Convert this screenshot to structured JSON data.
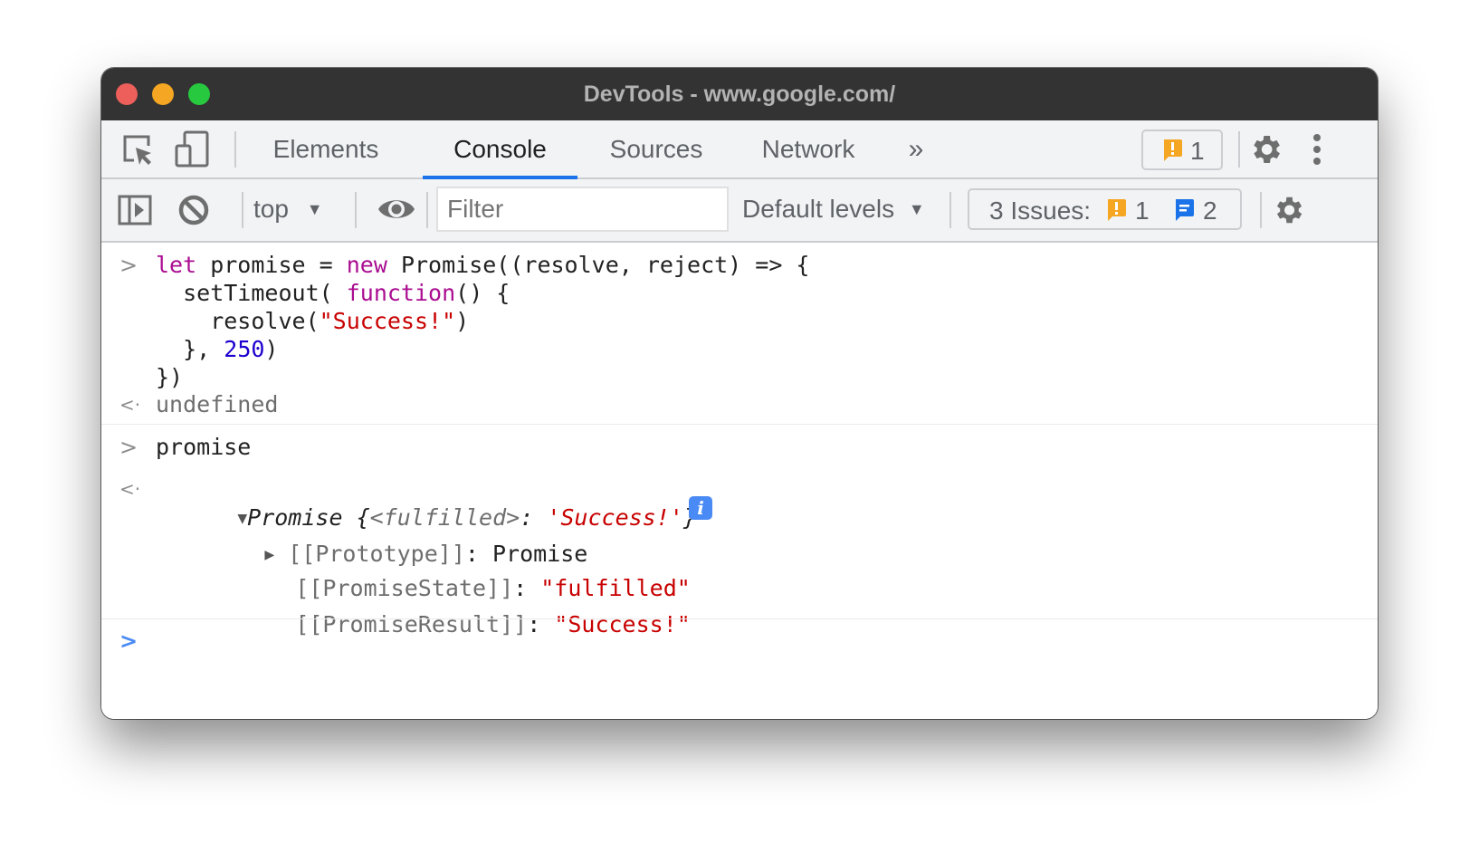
{
  "window": {
    "title": "DevTools - www.google.com/"
  },
  "tabbar": {
    "tabs": [
      {
        "label": "Elements",
        "active": false
      },
      {
        "label": "Console",
        "active": true
      },
      {
        "label": "Sources",
        "active": false
      },
      {
        "label": "Network",
        "active": false
      }
    ],
    "more_tabs_icon": "»",
    "issues_warning_count": "1",
    "settings_icon": "gear-icon",
    "menu_icon": "kebab-menu-icon"
  },
  "console_toolbar": {
    "context_label": "top",
    "filter_placeholder": "Filter",
    "levels_label": "Default levels",
    "issues_label": "3 Issues:",
    "issues_warning_count": "1",
    "issues_info_count": "2"
  },
  "console": {
    "entries": [
      {
        "type": "input",
        "lines": [
          [
            {
              "t": "let",
              "c": "kw"
            },
            {
              "t": " promise = ",
              "c": ""
            },
            {
              "t": "new",
              "c": "kw"
            },
            {
              "t": " Promise((resolve, reject) => {",
              "c": ""
            }
          ],
          [
            {
              "t": "  setTimeout( ",
              "c": ""
            },
            {
              "t": "function",
              "c": "kw"
            },
            {
              "t": "() {",
              "c": ""
            }
          ],
          [
            {
              "t": "    resolve(",
              "c": ""
            },
            {
              "t": "\"Success!\"",
              "c": "str"
            },
            {
              "t": ")",
              "c": ""
            }
          ],
          [
            {
              "t": "  }, ",
              "c": ""
            },
            {
              "t": "250",
              "c": "num"
            },
            {
              "t": ")",
              "c": ""
            }
          ],
          [
            {
              "t": "})",
              "c": ""
            }
          ]
        ]
      },
      {
        "type": "output",
        "text": "undefined"
      },
      {
        "type": "input",
        "text": "promise"
      },
      {
        "type": "output-object",
        "summary": {
          "name": "Promise",
          "open_brace": " {",
          "key": "<fulfilled>",
          "colon": ": ",
          "value": "'Success!'",
          "close_brace": "}"
        },
        "info_badge": "i",
        "properties": [
          {
            "key": "[[Prototype]]",
            "sep": ": ",
            "value": "Promise",
            "expandable": true,
            "value_type": "object"
          },
          {
            "key": "[[PromiseState]]",
            "sep": ": ",
            "value": "\"fulfilled\"",
            "expandable": false,
            "value_type": "string"
          },
          {
            "key": "[[PromiseResult]]",
            "sep": ": ",
            "value": "\"Success!\"",
            "expandable": false,
            "value_type": "string"
          }
        ]
      }
    ],
    "prompt_value": ""
  },
  "colors": {
    "accent": "#1a73e8",
    "warning": "#f5a623",
    "info": "#1a73e8",
    "keyword": "#aa0d91",
    "string": "#c80000",
    "number": "#1c00cf"
  }
}
